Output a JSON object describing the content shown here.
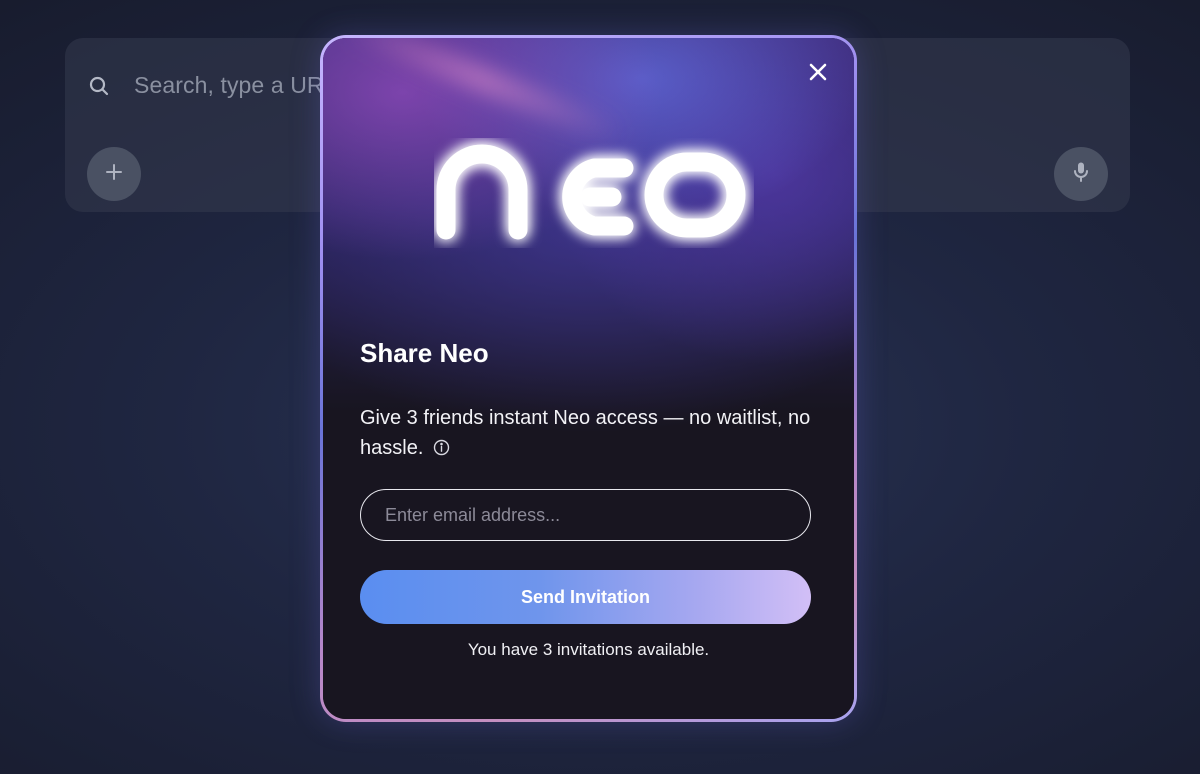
{
  "search": {
    "placeholder": "Search, type a UR",
    "icon": "search-icon",
    "add_icon": "plus-icon",
    "mic_icon": "microphone-icon"
  },
  "modal": {
    "logo_text": "NEO",
    "title": "Share Neo",
    "description": "Give 3 friends instant Neo access — no waitlist, no hassle.",
    "info_icon": "info-icon",
    "close_icon": "close-icon",
    "email_placeholder": "Enter email address...",
    "send_label": "Send Invitation",
    "invites_text": "You have 3 invitations available."
  },
  "colors": {
    "button_gradient_start": "#5a8ef0",
    "button_gradient_end": "#d2bff6",
    "modal_border": "#a89ff0",
    "background": "#1f2641"
  }
}
